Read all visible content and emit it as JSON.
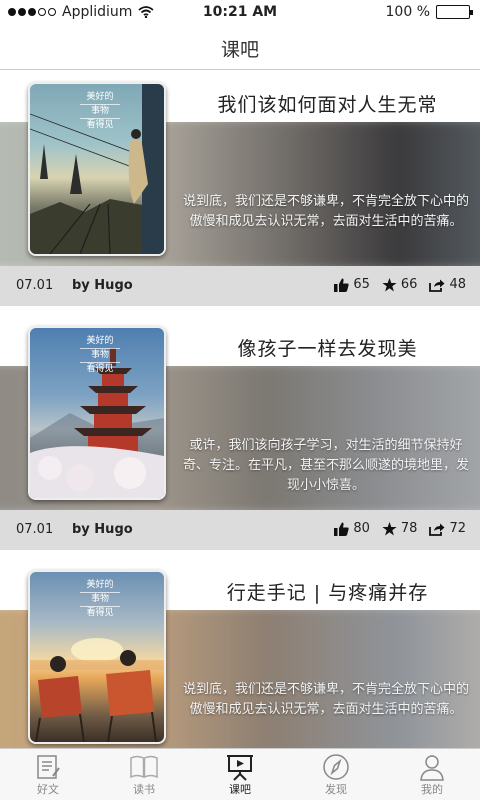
{
  "status_bar": {
    "carrier": "Applidium",
    "time": "10:21 AM",
    "battery": "100 %",
    "battery_level": 1.0,
    "signal_bars": 3
  },
  "navbar": {
    "title": "课吧"
  },
  "cards": [
    {
      "title": "我们该如何面对人生无常",
      "summary": "说到底，我们还是不够谦卑，不肯完全放下心中的傲慢和成见去认识无常，去面对生活中的苦痛。",
      "date": "07.01",
      "author": "by Hugo",
      "likes": "65",
      "favorites": "66",
      "shares": "48",
      "thumb_caption": [
        "美好的",
        "事物",
        "看得见"
      ]
    },
    {
      "title": "像孩子一样去发现美",
      "summary": "或许，我们该向孩子学习，对生活的细节保持好奇、专注。在平凡，甚至不那么顺遂的境地里，发现小小惊喜。",
      "date": "07.01",
      "author": "by Hugo",
      "likes": "80",
      "favorites": "78",
      "shares": "72",
      "thumb_caption": [
        "美好的",
        "事物",
        "看得见"
      ]
    },
    {
      "title": "行走手记 | 与疼痛并存",
      "summary": "说到底，我们还是不够谦卑，不肯完全放下心中的傲慢和成见去认识无常，去面对生活中的苦痛。",
      "thumb_caption": [
        "美好的",
        "事物",
        "看得见"
      ]
    }
  ],
  "tabs": [
    {
      "label": "好文",
      "icon": "article-icon",
      "active": false
    },
    {
      "label": "读书",
      "icon": "book-icon",
      "active": false
    },
    {
      "label": "课吧",
      "icon": "lecture-icon",
      "active": true
    },
    {
      "label": "发现",
      "icon": "compass-icon",
      "active": false
    },
    {
      "label": "我的",
      "icon": "profile-icon",
      "active": false
    }
  ],
  "colors": {
    "meta_bar": "#dcdcdc",
    "tab_active": "#222222",
    "tab_inactive": "#888888"
  }
}
